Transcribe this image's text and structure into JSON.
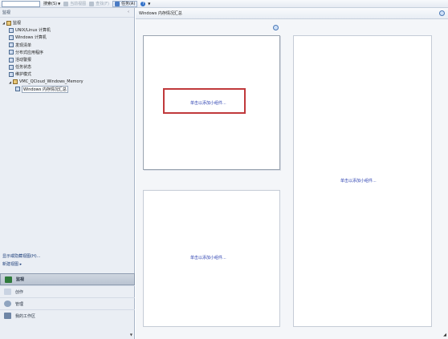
{
  "toolbar": {
    "search_label": "搜索(S)",
    "scope_label": "当前视图",
    "find_label": "查找(F)",
    "tasks_label": "任务(A)",
    "help_label": "?"
  },
  "left_pane": {
    "title": "监视",
    "tree": [
      {
        "label": "监视",
        "level": 1,
        "icon": "monitor-folder-icon"
      },
      {
        "label": "UNIX/Linux 计算机",
        "level": 2,
        "icon": "computer-view-icon"
      },
      {
        "label": "Windows 计算机",
        "level": 2,
        "icon": "computer-view-icon"
      },
      {
        "label": "发现清单",
        "level": 2,
        "icon": "list-view-icon"
      },
      {
        "label": "分布式应用程序",
        "level": 2,
        "icon": "distributed-app-icon"
      },
      {
        "label": "活动警报",
        "level": 2,
        "icon": "alert-view-icon"
      },
      {
        "label": "任务状态",
        "level": 2,
        "icon": "task-status-icon"
      },
      {
        "label": "维护模式",
        "level": 2,
        "icon": "maintenance-icon"
      },
      {
        "label": "VMC_QCloud_Windows_Memory",
        "level": 2,
        "icon": "folder-icon"
      },
      {
        "label": "Windows 内存情况汇总",
        "level": 3,
        "icon": "dashboard-view-icon",
        "selected": true
      }
    ],
    "links": {
      "show_more": "显示或隐藏视图(H)...",
      "new_view": "新建视图 ▸"
    },
    "nav": [
      {
        "label": "监视",
        "active": true,
        "icon": "monitoring-icon"
      },
      {
        "label": "创作",
        "active": false,
        "icon": "authoring-icon"
      },
      {
        "label": "管理",
        "active": false,
        "icon": "administration-icon"
      },
      {
        "label": "我的工作区",
        "active": false,
        "icon": "my-workspace-icon"
      }
    ]
  },
  "main": {
    "title": "Windows 内存情况汇总",
    "widget_placeholder_a": "单击以添加小组件...",
    "widget_placeholder_b": "单击以添加小组件...",
    "widget_placeholder_c": "单击以添加小组件..."
  }
}
